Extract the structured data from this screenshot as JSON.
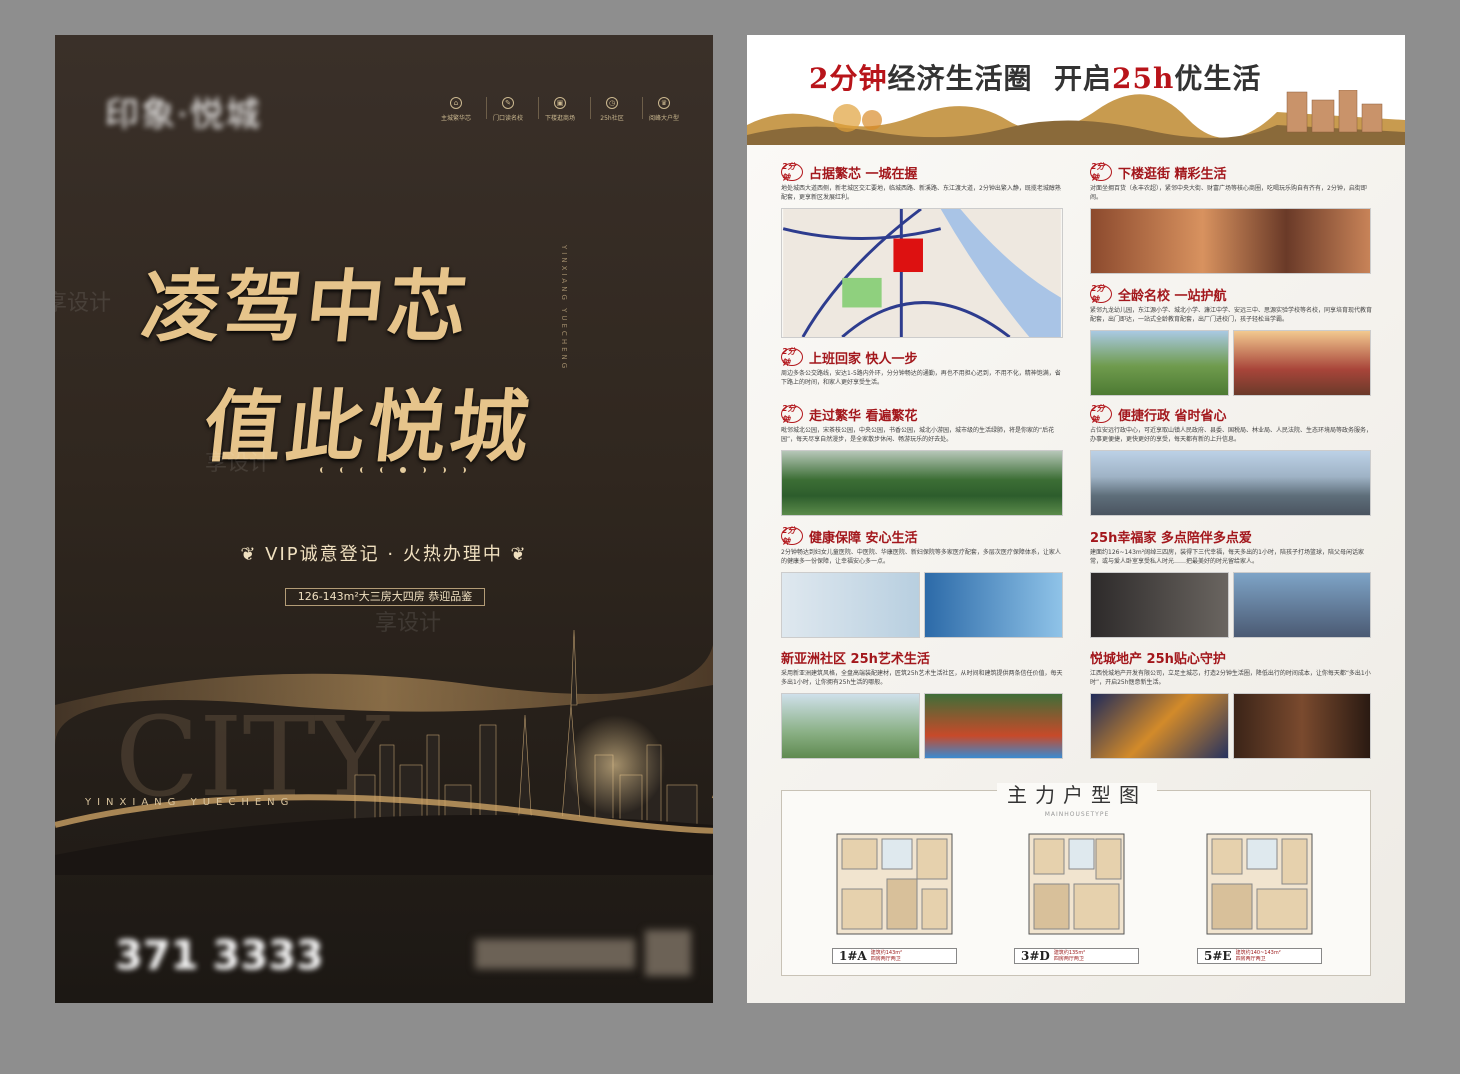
{
  "left": {
    "nav": [
      {
        "icon": "home-icon",
        "label": "主城繁华芯"
      },
      {
        "icon": "school-icon",
        "label": "门口读名校"
      },
      {
        "icon": "shop-icon",
        "label": "下楼逛商场"
      },
      {
        "icon": "clock-icon",
        "label": "25h社区"
      },
      {
        "icon": "crown-icon",
        "label": "阅峰大户型"
      }
    ],
    "headline_1": "凌驾中芯",
    "headline_2": "值此悦城",
    "side_words": "YINXIANG YUECHENG",
    "vip": "VIP诚意登记 · 火热办理中",
    "area": "126-143m²大三房大四房 恭迎品鉴",
    "city_bg_word": "CITY",
    "city_line": "YINXIANG YUECHENG",
    "phone": "371 3333"
  },
  "right": {
    "slogan_a": "2分钟",
    "slogan_b": "经济生活圈",
    "slogan_c": "开启",
    "slogan_d": "25h",
    "slogan_e": "优生活",
    "sections": [
      {
        "badge": "2分钟",
        "title": "占据繁芯  一城在握",
        "text": "地处城西大道西侧，新老城区交汇要地，临城西路、新溪路、东江渡大道，2分钟出繁入静，既揽老城醇熟配套，更享新区发展红利。"
      },
      {
        "badge": "2分钟",
        "title": "下楼逛街  精彩生活",
        "text": "对面坐拥百货（永丰农超），紧邻中央大街、财富广场等核心商圈，吃喝玩乐购自有齐有，2分钟，启街即闹。"
      },
      {
        "badge": "2分钟",
        "title": "上班回家  快人一步",
        "text": "周边多条公交路线，安达1-5路内外环，分分钟畅达的通勤，再也不用担心迟到，不用不化，精神饱满，省下路上的时间，和家人更好享受生活。"
      },
      {
        "badge": "2分钟",
        "title": "全龄名校  一站护航",
        "text": "紧邻九龙幼儿园，东江源小学、城北小学、濂江中学、安远三中、思源实验学校等名校，同享培育现代教育配套，出门即达，一站式全龄教育配套，出厂门进校门，孩子轻松当学霸。"
      },
      {
        "badge": "2分钟",
        "title": "走过繁华  看遍繁花",
        "text": "毗邻城北公园，宋茶枝公园，中央公园，书香公园，城北小游园，城市级的生活绿肺，将是你家的“后花园”，每天尽享自然漫步，是全家散步休闲、畅游玩乐的好去处。"
      },
      {
        "badge": "2分钟",
        "title": "便捷行政  省时省心",
        "text": "占位安远行政中心，可近享取山镇人民政府、县委、国税局、林业局、人民法院、生态环境局等政务服务，办事更便捷，更快更好的享受，每天都有新的上升信息。"
      },
      {
        "badge": "2分钟",
        "title": "健康保障  安心生活",
        "text": "2分钟畅达到妇女儿童医院、中医院、华康医院、新妇保院等多家医疗配套，多层次医疗保障体系，让家人的健康多一份保障，让幸福安心多一点。"
      },
      {
        "badge": "",
        "title": "25h幸福家  多点陪伴多点爱",
        "text": "建面约126~143m²阔绰三四房，装得下三代幸福，每天多出的1小时，陪孩子打场篮球，陪父母闲话家常，或与爱人卧室享受私人时光……把最美好的时光留给家人。"
      },
      {
        "badge": "",
        "title": "新亚洲社区  25h艺术生活",
        "text": "采用新亚洲建筑风格，全盘高端装配建材，匠筑25h艺术生活社区，从时间和建筑提供两条信任价值，每天多出1小时，让你拥有25h生活的哪般。"
      },
      {
        "badge": "",
        "title": "悦城地产  25h贴心守护",
        "text": "江西悦城地产开发有限公司，立足主城芯，打造2分钟生活圈，降低出行的时间成本，让你每天都“多出1小时”，开启25h惬意新生活。"
      }
    ],
    "plans_title": "主力户型图",
    "plans_subtitle": "MAINHOUSETYPE",
    "plans": [
      {
        "code": "1#A",
        "spec": "建筑约143m²\n四房两厅两卫"
      },
      {
        "code": "3#D",
        "spec": "建筑约135m²\n四房两厅两卫"
      },
      {
        "code": "5#E",
        "spec": "建筑约140~143m²\n四房两厅两卫"
      }
    ],
    "watermark": "享设计"
  }
}
